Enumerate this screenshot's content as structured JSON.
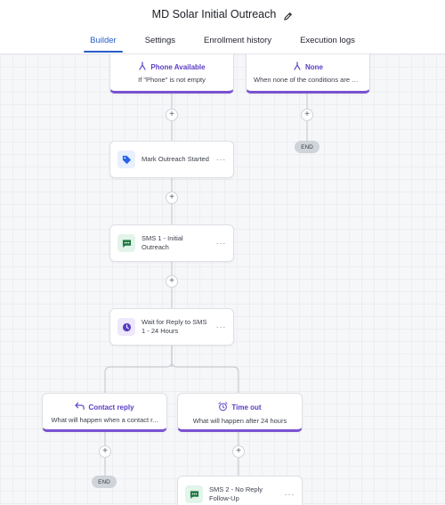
{
  "header": {
    "title": "MD Solar Initial Outreach",
    "tabs": [
      "Builder",
      "Settings",
      "Enrollment history",
      "Execution logs"
    ],
    "active_tab": "Builder"
  },
  "colors": {
    "accent": "#2a5cc9",
    "branch": "#7a52d1",
    "branch_text": "#5b3cc4",
    "tag_icon": "#2563eb",
    "sms_icon": "#1f7a45",
    "wait_icon": "#5b3cc4"
  },
  "nodes": {
    "phone_available": {
      "title": "Phone Available",
      "subtitle": "If \"Phone\" is not empty",
      "icon": "branch-icon"
    },
    "none_branch": {
      "title": "None",
      "subtitle": "When none of the conditions are met",
      "icon": "branch-icon"
    },
    "end_top": {
      "label": "END"
    },
    "mark_outreach": {
      "label": "Mark Outreach Started",
      "icon": "tag-icon"
    },
    "sms_1": {
      "label": "SMS 1 - Initial Outreach",
      "icon": "sms-icon"
    },
    "wait_reply": {
      "label": "Wait for Reply to SMS 1 - 24 Hours",
      "icon": "clock-icon"
    },
    "contact_reply": {
      "title": "Contact reply",
      "subtitle": "What will happen when a contact r...",
      "icon": "reply-icon"
    },
    "time_out": {
      "title": "Time out",
      "subtitle": "What will happen after 24 hours",
      "icon": "alarm-clock-icon"
    },
    "end_bottom": {
      "label": "END"
    },
    "sms_2": {
      "label": "SMS 2 - No Reply Follow-Up",
      "icon": "sms-icon"
    }
  },
  "add_step_symbol": "+",
  "more_symbol": "···"
}
